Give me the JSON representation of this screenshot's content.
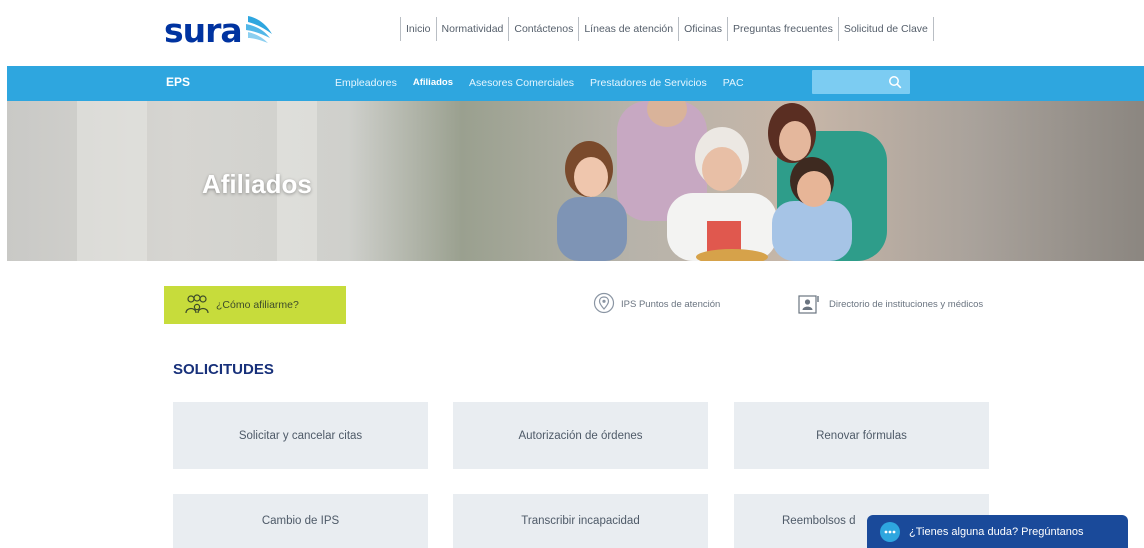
{
  "brand": {
    "logo_text": "sura"
  },
  "top_nav": {
    "items": [
      "Inicio",
      "Normatividad",
      "Contáctenos",
      "Líneas de atención",
      "Oficinas",
      "Preguntas frecuentes",
      "Solicitud de Clave"
    ]
  },
  "main_bar": {
    "section_label": "EPS",
    "items": [
      "Empleadores",
      "Afiliados",
      "Asesores Comerciales",
      "Prestadores de Servicios",
      "PAC"
    ],
    "active_item": "Afiliados",
    "search": {
      "value": "",
      "placeholder": ""
    },
    "accent_color": "#2ea6df"
  },
  "hero": {
    "title": "Afiliados"
  },
  "quick_links": {
    "afiliar": "¿Cómo afiliarme?",
    "ips": "IPS Puntos de atención",
    "directorio": "Directorio de instituciones y médicos"
  },
  "solicitudes": {
    "heading": "SOLICITUDES",
    "cards": [
      "Solicitar y cancelar citas",
      "Autorización de órdenes",
      "Renovar fórmulas",
      "Cambio de IPS",
      "Transcribir incapacidad",
      "Reembolsos d"
    ]
  },
  "chat": {
    "label": "¿Tienes alguna duda? Pregúntanos",
    "color": "#1a4a9a"
  },
  "icons": [
    "logo-wing-icon",
    "search-icon",
    "people-icon",
    "location-pin-icon",
    "directory-icon",
    "chat-bubble-icon"
  ]
}
